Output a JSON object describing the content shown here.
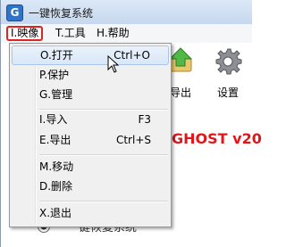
{
  "window": {
    "title": "一键恢复系统",
    "app_icon_letter": "G"
  },
  "menubar": {
    "items": [
      {
        "label": "I.映像",
        "active": true
      },
      {
        "label": "T.工具"
      },
      {
        "label": "H.帮助"
      }
    ]
  },
  "dropdown": {
    "items": [
      {
        "label": "O.打开",
        "shortcut": "Ctrl+O",
        "highlight": true
      },
      {
        "label": "P.保护",
        "shortcut": ""
      },
      {
        "label": "G.管理",
        "shortcut": ""
      },
      {
        "label": "I.导入",
        "shortcut": "F3"
      },
      {
        "label": "E.导出",
        "shortcut": "Ctrl+S"
      },
      {
        "label": "M.移动",
        "shortcut": ""
      },
      {
        "label": "D.删除",
        "shortcut": ""
      },
      {
        "label": "X.退出",
        "shortcut": ""
      }
    ]
  },
  "toolbar": {
    "export_label": "导出",
    "settings_label": "设置"
  },
  "content": {
    "ghost_title": "GHOST v20",
    "radio_label": "一键恢复系统"
  },
  "colors": {
    "accent_red": "#e02424",
    "ghost_red": "#e0161b",
    "highlight": "#d9e7f8"
  }
}
